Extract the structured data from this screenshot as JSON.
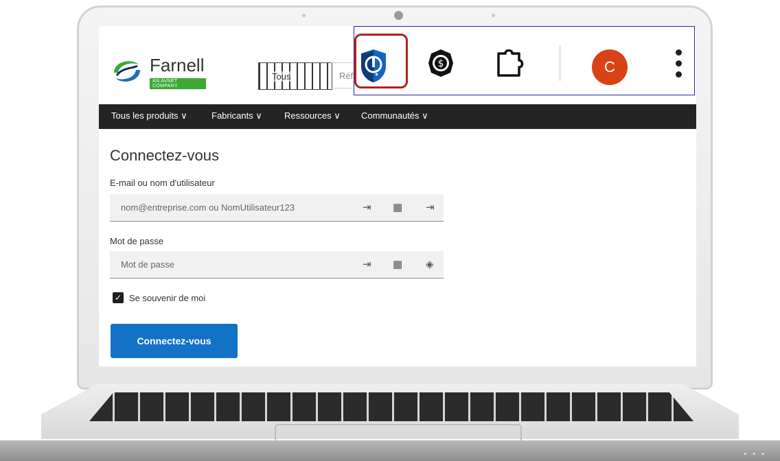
{
  "site": {
    "logo_text": "Farnell",
    "logo_tag": "AN AVNET COMPANY",
    "search_prefix": "Tous",
    "search_placeholder": "Réf"
  },
  "nav": {
    "items": [
      {
        "label": "Tous les produits ∨"
      },
      {
        "label": "Fabricants ∨"
      },
      {
        "label": "Ressources ∨"
      },
      {
        "label": "Communautés ∨"
      }
    ]
  },
  "login": {
    "title": "Connectez-vous",
    "email_label": "E-mail ou nom d'utilisateur",
    "email_placeholder": "nom@entreprise.com ou NomUtilisateur123",
    "password_label": "Mot de passe",
    "password_placeholder": "Mot de passe",
    "remember_label": "Se souvenir de moi",
    "remember_checked": true,
    "submit_label": "Connectez-vous"
  },
  "toolbar": {
    "avatar_letter": "C",
    "icons": [
      "password-manager-extension-icon",
      "dollar-shield-extension-icon",
      "extensions-puzzle-icon",
      "more-vert-icon"
    ]
  },
  "colors": {
    "nav_bg": "#242424",
    "button_blue": "#1372c8",
    "avatar_orange": "#d84315",
    "highlight_red": "#b51f1f",
    "toolbar_border": "#1d2a9c",
    "brand_green": "#3aaa35"
  }
}
